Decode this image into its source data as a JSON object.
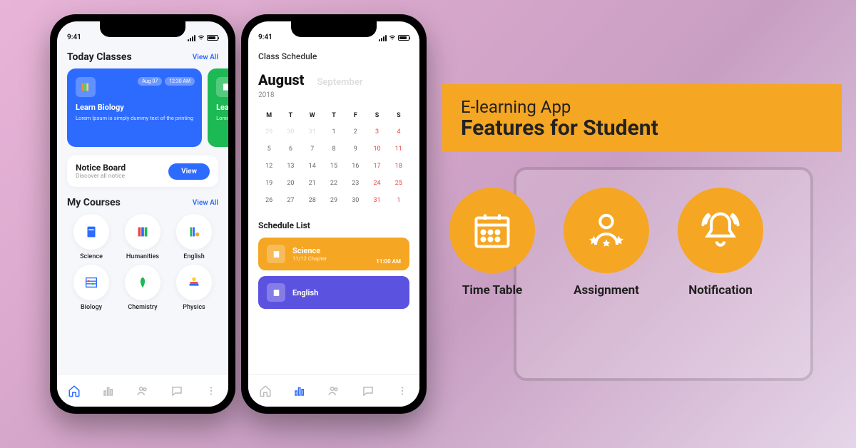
{
  "status": {
    "time": "9:41"
  },
  "phone1": {
    "today": {
      "heading": "Today Classes",
      "view_all": "View All"
    },
    "card1": {
      "title": "Learn Biology",
      "desc": "Lorem Ipsum is simply dummy text of the printing",
      "badge_date": "Aug 07",
      "badge_time": "12:30 AM"
    },
    "card2": {
      "title": "Learn Bio",
      "desc": "Lorem Ipsum is simply text of the pr"
    },
    "notice": {
      "title": "Notice Board",
      "sub": "Discover all notice",
      "btn": "View"
    },
    "courses": {
      "heading": "My Courses",
      "view_all": "View All",
      "items": [
        "Science",
        "Humanities",
        "English",
        "Biology",
        "Chemistry",
        "Physics"
      ]
    }
  },
  "phone2": {
    "heading": "Class Schedule",
    "month_main": "August",
    "month_next": "September",
    "year": "2018",
    "days": [
      "M",
      "T",
      "W",
      "T",
      "F",
      "S",
      "S"
    ],
    "grid": [
      {
        "n": "29",
        "dim": true
      },
      {
        "n": "30",
        "dim": true
      },
      {
        "n": "31",
        "dim": true
      },
      {
        "n": "1"
      },
      {
        "n": "2"
      },
      {
        "n": "3",
        "red": true
      },
      {
        "n": "4",
        "red": true
      },
      {
        "n": "5"
      },
      {
        "n": "6"
      },
      {
        "n": "7"
      },
      {
        "n": "8",
        "today": true
      },
      {
        "n": "9"
      },
      {
        "n": "10",
        "red": true
      },
      {
        "n": "11",
        "red": true
      },
      {
        "n": "12"
      },
      {
        "n": "13"
      },
      {
        "n": "14"
      },
      {
        "n": "15"
      },
      {
        "n": "16"
      },
      {
        "n": "17",
        "red": true
      },
      {
        "n": "18",
        "red": true
      },
      {
        "n": "19"
      },
      {
        "n": "20"
      },
      {
        "n": "21"
      },
      {
        "n": "22"
      },
      {
        "n": "23"
      },
      {
        "n": "24",
        "red": true
      },
      {
        "n": "25",
        "red": true
      },
      {
        "n": "26"
      },
      {
        "n": "27"
      },
      {
        "n": "28"
      },
      {
        "n": "29"
      },
      {
        "n": "30"
      },
      {
        "n": "31",
        "red": true
      },
      {
        "n": "1",
        "dim": true,
        "red": true
      }
    ],
    "sched_heading": "Schedule List",
    "sched1": {
      "name": "Science",
      "sub": "11/12 Chapter",
      "time": "11:00 AM"
    },
    "sched2": {
      "name": "English"
    }
  },
  "right": {
    "hl1": "E-learning App",
    "hl2": "Features for Student",
    "features": [
      "Time Table",
      "Assignment",
      "Notification"
    ]
  }
}
